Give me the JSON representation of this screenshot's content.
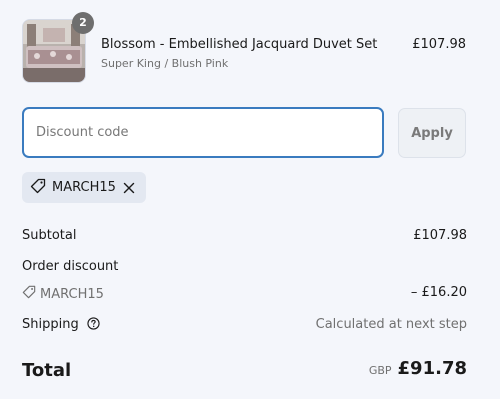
{
  "product": {
    "quantity": "2",
    "title": "Blossom - Embellished Jacquard Duvet Set",
    "variant": "Super King / Blush Pink",
    "price": "£107.98"
  },
  "discount": {
    "placeholder": "Discount code",
    "apply_label": "Apply",
    "applied_code": "MARCH15"
  },
  "summary": {
    "subtotal_label": "Subtotal",
    "subtotal_value": "£107.98",
    "order_discount_label": "Order discount",
    "discount_code": "MARCH15",
    "discount_value": "– £16.20",
    "shipping_label": "Shipping",
    "shipping_value": "Calculated at next step",
    "total_label": "Total",
    "currency": "GBP",
    "total_value": "£91.78"
  },
  "colors": {
    "background": "#f4f6fb",
    "focus_border": "#3a7bbf",
    "chip_background": "#e3e8f1"
  },
  "icons": {
    "tag": "tag-icon",
    "remove": "close-icon",
    "help": "question-circle-icon"
  }
}
